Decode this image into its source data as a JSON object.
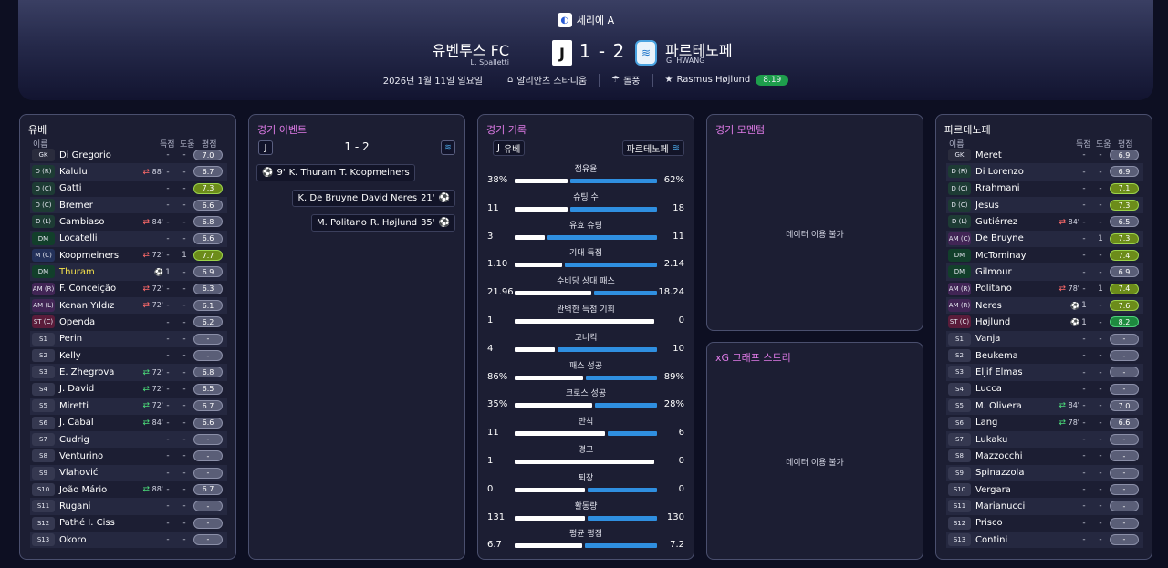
{
  "competition": "세리에 A",
  "home": {
    "name": "유벤투스 FC",
    "manager": "L. Spalletti",
    "short": "유베"
  },
  "away": {
    "name": "파르테노페",
    "manager": "G. HWANG",
    "short": "파르테노페"
  },
  "score": "1 - 2",
  "info": {
    "date": "2026년 1월 11일 일요일",
    "stadium": "알리안츠 스타디움",
    "weather": "돌풍",
    "motm": "Rasmus Højlund",
    "motm_rating": "8.19"
  },
  "lineup_headers": {
    "name": "이름",
    "goals": "득점",
    "assists": "도움",
    "rating": "평점"
  },
  "home_lineup": [
    {
      "pos": "GK",
      "cls": "gk",
      "name": "Di Gregorio",
      "evt": "",
      "g": "-",
      "a": "-",
      "r": "7.0",
      "rc": ""
    },
    {
      "pos": "D (R)",
      "cls": "df",
      "name": "Kalulu",
      "evt": "out",
      "min": "88'",
      "g": "-",
      "a": "-",
      "r": "6.7",
      "rc": ""
    },
    {
      "pos": "D (C)",
      "cls": "df",
      "name": "Gatti",
      "evt": "",
      "g": "-",
      "a": "-",
      "r": "7.3",
      "rc": "good"
    },
    {
      "pos": "D (C)",
      "cls": "df",
      "name": "Bremer",
      "evt": "",
      "g": "-",
      "a": "-",
      "r": "6.6",
      "rc": ""
    },
    {
      "pos": "D (L)",
      "cls": "df",
      "name": "Cambiaso",
      "evt": "out",
      "min": "84'",
      "g": "-",
      "a": "-",
      "r": "6.8",
      "rc": ""
    },
    {
      "pos": "DM",
      "cls": "dm",
      "name": "Locatelli",
      "evt": "",
      "g": "-",
      "a": "-",
      "r": "6.6",
      "rc": ""
    },
    {
      "pos": "M (C)",
      "cls": "mc",
      "name": "Koopmeiners",
      "evt": "out",
      "min": "72'",
      "g": "-",
      "a": "1",
      "r": "7.7",
      "rc": "good"
    },
    {
      "pos": "DM",
      "cls": "dm",
      "name": "Thuram",
      "evt": "goal",
      "g": "1",
      "a": "-",
      "r": "6.9",
      "rc": "",
      "hl": true
    },
    {
      "pos": "AM (R)",
      "cls": "am",
      "name": "F. Conceição",
      "evt": "out",
      "min": "72'",
      "g": "-",
      "a": "-",
      "r": "6.3",
      "rc": ""
    },
    {
      "pos": "AM (L)",
      "cls": "am",
      "name": "Kenan Yıldız",
      "evt": "out",
      "min": "72'",
      "g": "-",
      "a": "-",
      "r": "6.1",
      "rc": ""
    },
    {
      "pos": "ST (C)",
      "cls": "st",
      "name": "Openda",
      "evt": "",
      "g": "-",
      "a": "-",
      "r": "6.2",
      "rc": ""
    },
    {
      "pos": "S1",
      "cls": "sub",
      "name": "Perin",
      "evt": "",
      "g": "-",
      "a": "-",
      "r": "-",
      "rc": ""
    },
    {
      "pos": "S2",
      "cls": "sub",
      "name": "Kelly",
      "evt": "",
      "g": "-",
      "a": "-",
      "r": "-",
      "rc": ""
    },
    {
      "pos": "S3",
      "cls": "sub",
      "name": "E. Zhegrova",
      "evt": "in",
      "min": "72'",
      "g": "-",
      "a": "-",
      "r": "6.8",
      "rc": ""
    },
    {
      "pos": "S4",
      "cls": "sub",
      "name": "J. David",
      "evt": "in",
      "min": "72'",
      "g": "-",
      "a": "-",
      "r": "6.5",
      "rc": ""
    },
    {
      "pos": "S5",
      "cls": "sub",
      "name": "Miretti",
      "evt": "in",
      "min": "72'",
      "g": "-",
      "a": "-",
      "r": "6.7",
      "rc": ""
    },
    {
      "pos": "S6",
      "cls": "sub",
      "name": "J. Cabal",
      "evt": "in",
      "min": "84'",
      "g": "-",
      "a": "-",
      "r": "6.6",
      "rc": ""
    },
    {
      "pos": "S7",
      "cls": "sub",
      "name": "Cudrig",
      "evt": "",
      "g": "-",
      "a": "-",
      "r": "-",
      "rc": ""
    },
    {
      "pos": "S8",
      "cls": "sub",
      "name": "Venturino",
      "evt": "",
      "g": "-",
      "a": "-",
      "r": "-",
      "rc": ""
    },
    {
      "pos": "S9",
      "cls": "sub",
      "name": "Vlahović",
      "evt": "",
      "g": "-",
      "a": "-",
      "r": "-",
      "rc": ""
    },
    {
      "pos": "S10",
      "cls": "sub",
      "name": "João Mário",
      "evt": "in",
      "min": "88'",
      "g": "-",
      "a": "-",
      "r": "6.7",
      "rc": ""
    },
    {
      "pos": "S11",
      "cls": "sub",
      "name": "Rugani",
      "evt": "",
      "g": "-",
      "a": "-",
      "r": "-",
      "rc": ""
    },
    {
      "pos": "S12",
      "cls": "sub",
      "name": "Pathé I. Ciss",
      "evt": "",
      "g": "-",
      "a": "-",
      "r": "-",
      "rc": ""
    },
    {
      "pos": "S13",
      "cls": "sub",
      "name": "Okoro",
      "evt": "",
      "g": "-",
      "a": "-",
      "r": "-",
      "rc": ""
    }
  ],
  "away_lineup": [
    {
      "pos": "GK",
      "cls": "gk",
      "name": "Meret",
      "evt": "",
      "g": "-",
      "a": "-",
      "r": "6.9",
      "rc": ""
    },
    {
      "pos": "D (R)",
      "cls": "df",
      "name": "Di Lorenzo",
      "evt": "",
      "g": "-",
      "a": "-",
      "r": "6.9",
      "rc": ""
    },
    {
      "pos": "D (C)",
      "cls": "df",
      "name": "Rrahmani",
      "evt": "",
      "g": "-",
      "a": "-",
      "r": "7.1",
      "rc": "good"
    },
    {
      "pos": "D (C)",
      "cls": "df",
      "name": "Jesus",
      "evt": "",
      "g": "-",
      "a": "-",
      "r": "7.3",
      "rc": "good"
    },
    {
      "pos": "D (L)",
      "cls": "df",
      "name": "Gutiérrez",
      "evt": "out",
      "min": "84'",
      "g": "-",
      "a": "-",
      "r": "6.5",
      "rc": ""
    },
    {
      "pos": "AM (C)",
      "cls": "am",
      "name": "De Bruyne",
      "evt": "",
      "g": "-",
      "a": "1",
      "r": "7.3",
      "rc": "good"
    },
    {
      "pos": "DM",
      "cls": "dm",
      "name": "McTominay",
      "evt": "",
      "g": "-",
      "a": "-",
      "r": "7.4",
      "rc": "good"
    },
    {
      "pos": "DM",
      "cls": "dm",
      "name": "Gilmour",
      "evt": "",
      "g": "-",
      "a": "-",
      "r": "6.9",
      "rc": ""
    },
    {
      "pos": "AM (R)",
      "cls": "am",
      "name": "Politano",
      "evt": "out",
      "min": "78'",
      "g": "-",
      "a": "1",
      "r": "7.4",
      "rc": "good"
    },
    {
      "pos": "AM (R)",
      "cls": "am",
      "name": "Neres",
      "evt": "goal",
      "g": "1",
      "a": "-",
      "r": "7.6",
      "rc": "good"
    },
    {
      "pos": "ST (C)",
      "cls": "st",
      "name": "Højlund",
      "evt": "goal",
      "g": "1",
      "a": "-",
      "r": "8.2",
      "rc": "great"
    },
    {
      "pos": "S1",
      "cls": "sub",
      "name": "Vanja",
      "evt": "",
      "g": "-",
      "a": "-",
      "r": "-",
      "rc": ""
    },
    {
      "pos": "S2",
      "cls": "sub",
      "name": "Beukema",
      "evt": "",
      "g": "-",
      "a": "-",
      "r": "-",
      "rc": ""
    },
    {
      "pos": "S3",
      "cls": "sub",
      "name": "Eljif Elmas",
      "evt": "",
      "g": "-",
      "a": "-",
      "r": "-",
      "rc": ""
    },
    {
      "pos": "S4",
      "cls": "sub",
      "name": "Lucca",
      "evt": "",
      "g": "-",
      "a": "-",
      "r": "-",
      "rc": ""
    },
    {
      "pos": "S5",
      "cls": "sub",
      "name": "M. Olivera",
      "evt": "in",
      "min": "84'",
      "g": "-",
      "a": "-",
      "r": "7.0",
      "rc": ""
    },
    {
      "pos": "S6",
      "cls": "sub",
      "name": "Lang",
      "evt": "in",
      "min": "78'",
      "g": "-",
      "a": "-",
      "r": "6.6",
      "rc": ""
    },
    {
      "pos": "S7",
      "cls": "sub",
      "name": "Lukaku",
      "evt": "",
      "g": "-",
      "a": "-",
      "r": "-",
      "rc": ""
    },
    {
      "pos": "S8",
      "cls": "sub",
      "name": "Mazzocchi",
      "evt": "",
      "g": "-",
      "a": "-",
      "r": "-",
      "rc": ""
    },
    {
      "pos": "S9",
      "cls": "sub",
      "name": "Spinazzola",
      "evt": "",
      "g": "-",
      "a": "-",
      "r": "-",
      "rc": ""
    },
    {
      "pos": "S10",
      "cls": "sub",
      "name": "Vergara",
      "evt": "",
      "g": "-",
      "a": "-",
      "r": "-",
      "rc": ""
    },
    {
      "pos": "S11",
      "cls": "sub",
      "name": "Marianucci",
      "evt": "",
      "g": "-",
      "a": "-",
      "r": "-",
      "rc": ""
    },
    {
      "pos": "S12",
      "cls": "sub",
      "name": "Prisco",
      "evt": "",
      "g": "-",
      "a": "-",
      "r": "-",
      "rc": ""
    },
    {
      "pos": "S13",
      "cls": "sub",
      "name": "Contini",
      "evt": "",
      "g": "-",
      "a": "-",
      "r": "-",
      "rc": ""
    }
  ],
  "events": {
    "title": "경기 이벤트",
    "score": "1 - 2",
    "items": [
      {
        "side": "home",
        "minute": "9'",
        "scorer": "K. Thuram",
        "assist": "T. Koopmeiners"
      },
      {
        "side": "away",
        "minute": "21'",
        "scorer": "David Neres",
        "assist": "K. De Bruyne"
      },
      {
        "side": "away",
        "minute": "35'",
        "scorer": "R. Højlund",
        "assist": "M. Politano"
      }
    ]
  },
  "stats": {
    "title": "경기 기록",
    "home_label": "유베",
    "away_label": "파르테노페",
    "rows": [
      {
        "label": "점유율",
        "home": "38%",
        "away": "62%",
        "hv": 38,
        "av": 62
      },
      {
        "label": "슈팅 수",
        "home": "11",
        "away": "18",
        "hv": 11,
        "av": 18
      },
      {
        "label": "유효 슈팅",
        "home": "3",
        "away": "11",
        "hv": 3,
        "av": 11
      },
      {
        "label": "기대 득점",
        "home": "1.10",
        "away": "2.14",
        "hv": 1.1,
        "av": 2.14
      },
      {
        "label": "수비당 상대 패스",
        "home": "21.96",
        "away": "18.24",
        "hv": 21.96,
        "av": 18.24
      },
      {
        "label": "완벽한 득점 기회",
        "home": "1",
        "away": "0",
        "hv": 1,
        "av": 0
      },
      {
        "label": "코너킥",
        "home": "4",
        "away": "10",
        "hv": 4,
        "av": 10
      },
      {
        "label": "패스 성공",
        "home": "86%",
        "away": "89%",
        "hv": 86,
        "av": 89
      },
      {
        "label": "크로스 성공",
        "home": "35%",
        "away": "28%",
        "hv": 35,
        "av": 28
      },
      {
        "label": "반칙",
        "home": "11",
        "away": "6",
        "hv": 11,
        "av": 6
      },
      {
        "label": "경고",
        "home": "1",
        "away": "0",
        "hv": 1,
        "av": 0
      },
      {
        "label": "퇴장",
        "home": "0",
        "away": "0",
        "hv": 0,
        "av": 0
      },
      {
        "label": "활동량",
        "home": "131",
        "away": "130",
        "hv": 131,
        "av": 130
      },
      {
        "label": "평균 평점",
        "home": "6.7",
        "away": "7.2",
        "hv": 6.7,
        "av": 7.2
      }
    ]
  },
  "momentum": {
    "title": "경기 모멘텀",
    "na": "데이터 이용 불가"
  },
  "xg": {
    "title": "xG 그래프 스토리",
    "na": "데이터 이용 불가"
  },
  "colors": {
    "accent_pink": "#e07be8",
    "bar_away": "#2f8fe0",
    "rating_green": "#1e9e4c"
  }
}
